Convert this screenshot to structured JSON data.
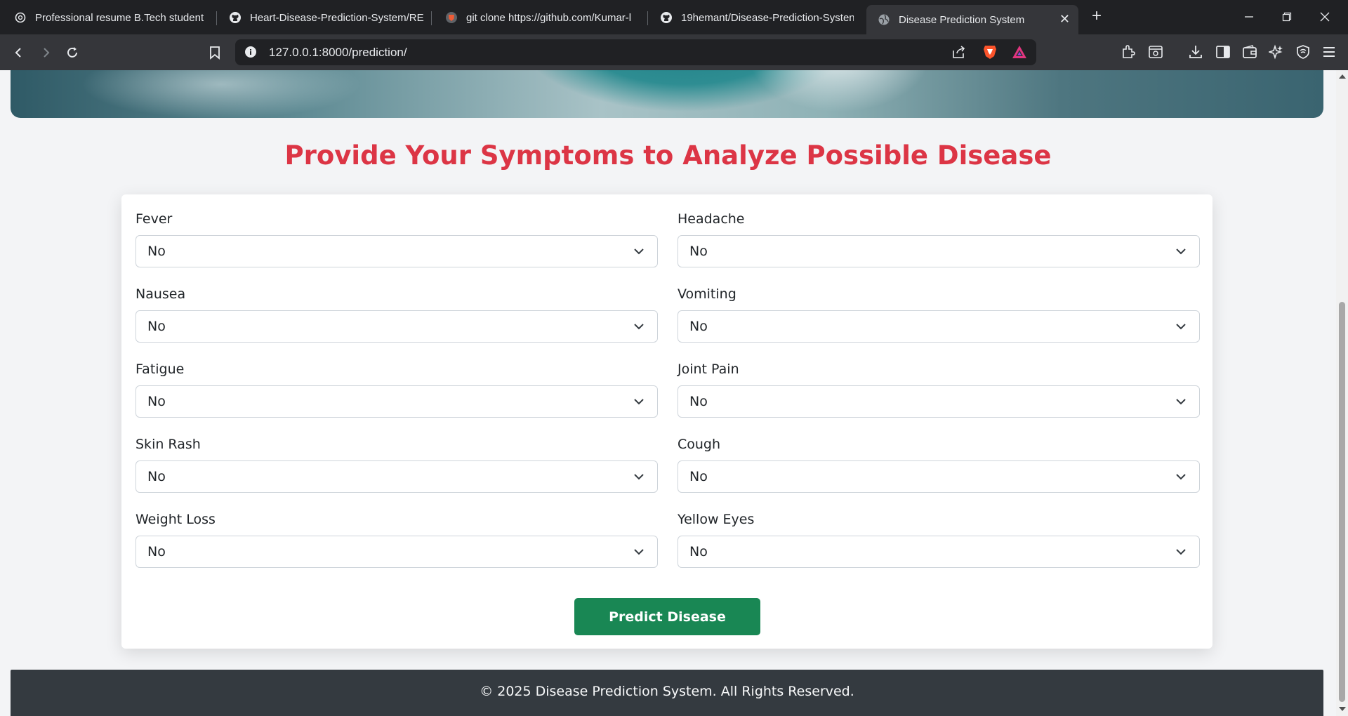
{
  "browser": {
    "tabs": [
      {
        "title": "Professional resume B.Tech student",
        "icon": "openai-icon"
      },
      {
        "title": "Heart-Disease-Prediction-System/REA",
        "icon": "github-icon"
      },
      {
        "title": "git clone https://github.com/Kumar-l",
        "icon": "brave-shield-icon"
      },
      {
        "title": "19hemant/Disease-Prediction-Systen",
        "icon": "github-icon"
      },
      {
        "title": "Disease Prediction System",
        "icon": "globe-icon"
      }
    ],
    "url": "127.0.0.1:8000/prediction/"
  },
  "page": {
    "heading": "Provide Your Symptoms to Analyze Possible Disease",
    "fields": [
      {
        "label": "Fever",
        "value": "No"
      },
      {
        "label": "Headache",
        "value": "No"
      },
      {
        "label": "Nausea",
        "value": "No"
      },
      {
        "label": "Vomiting",
        "value": "No"
      },
      {
        "label": "Fatigue",
        "value": "No"
      },
      {
        "label": "Joint Pain",
        "value": "No"
      },
      {
        "label": "Skin Rash",
        "value": "No"
      },
      {
        "label": "Cough",
        "value": "No"
      },
      {
        "label": "Weight Loss",
        "value": "No"
      },
      {
        "label": "Yellow Eyes",
        "value": "No"
      }
    ],
    "submit_label": "Predict Disease",
    "footer": "© 2025 Disease Prediction System. All Rights Reserved."
  },
  "colors": {
    "heading": "#dc3545",
    "button": "#198754",
    "footer": "#343a40"
  }
}
